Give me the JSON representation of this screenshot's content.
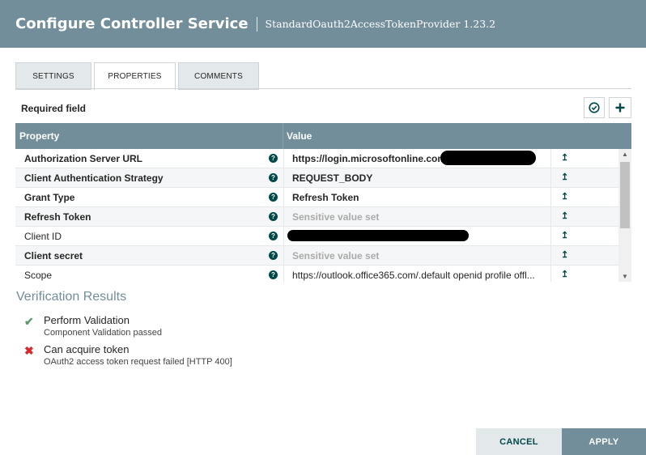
{
  "header": {
    "title": "Configure Controller Service",
    "subtitle": "StandardOauth2AccessTokenProvider 1.23.2"
  },
  "tabs": [
    {
      "label": "SETTINGS",
      "active": false
    },
    {
      "label": "PROPERTIES",
      "active": true
    },
    {
      "label": "COMMENTS",
      "active": false
    }
  ],
  "required_label": "Required field",
  "toolbar": {
    "verify_icon": "check-circle-icon",
    "add_icon": "plus-icon"
  },
  "table": {
    "col_property": "Property",
    "col_value": "Value",
    "rows": [
      {
        "name": "Authorization Server URL",
        "required": true,
        "value": "https://login.microsoftonline.com",
        "value_style": "bold",
        "redacted": true
      },
      {
        "name": "Client Authentication Strategy",
        "required": true,
        "value": "REQUEST_BODY",
        "value_style": "bold",
        "redacted": false
      },
      {
        "name": "Grant Type",
        "required": true,
        "value": "Refresh Token",
        "value_style": "bold",
        "redacted": false
      },
      {
        "name": "Refresh Token",
        "required": true,
        "value": "Sensitive value set",
        "value_style": "sensitive",
        "redacted": false
      },
      {
        "name": "Client ID",
        "required": false,
        "value": "",
        "value_style": "normal",
        "redacted": true
      },
      {
        "name": "Client secret",
        "required": true,
        "value": "Sensitive value set",
        "value_style": "sensitive",
        "redacted": false
      },
      {
        "name": "Scope",
        "required": false,
        "value": "https://outlook.office365.com/.default openid profile offl...",
        "value_style": "normal",
        "redacted": false
      }
    ]
  },
  "verification": {
    "title": "Verification Results",
    "items": [
      {
        "status": "success",
        "title": "Perform Validation",
        "detail": "Component Validation passed"
      },
      {
        "status": "failure",
        "title": "Can acquire token",
        "detail": "OAuth2 access token request failed [HTTP 400]"
      }
    ]
  },
  "footer": {
    "cancel_label": "CANCEL",
    "apply_label": "APPLY"
  },
  "colors": {
    "header": "#728e9b",
    "accent": "#004849",
    "success": "#5c9c6c",
    "failure": "#d9272e"
  }
}
